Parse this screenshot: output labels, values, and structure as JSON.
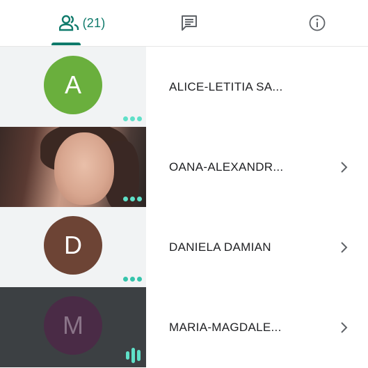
{
  "tabs": {
    "people_count": "(21)",
    "icons": [
      "people-icon",
      "chat-icon",
      "info-icon"
    ],
    "accent": "#0f7a6b"
  },
  "participants": [
    {
      "initial": "A",
      "name": "ALICE-LETITIA SA...",
      "avatar_color": "#6aaf3d",
      "tile": "light",
      "status": "dots",
      "chevron": false
    },
    {
      "initial": "",
      "name": "OANA-ALEXANDR...",
      "avatar_color": "",
      "tile": "video",
      "status": "dots",
      "chevron": true
    },
    {
      "initial": "D",
      "name": "DANIELA DAMIAN",
      "avatar_color": "#6d4435",
      "tile": "light",
      "status": "dots",
      "chevron": true
    },
    {
      "initial": "M",
      "name": "MARIA-MAGDALE...",
      "avatar_color": "#4a2b46",
      "tile": "dark",
      "status": "speaking",
      "chevron": true
    }
  ]
}
